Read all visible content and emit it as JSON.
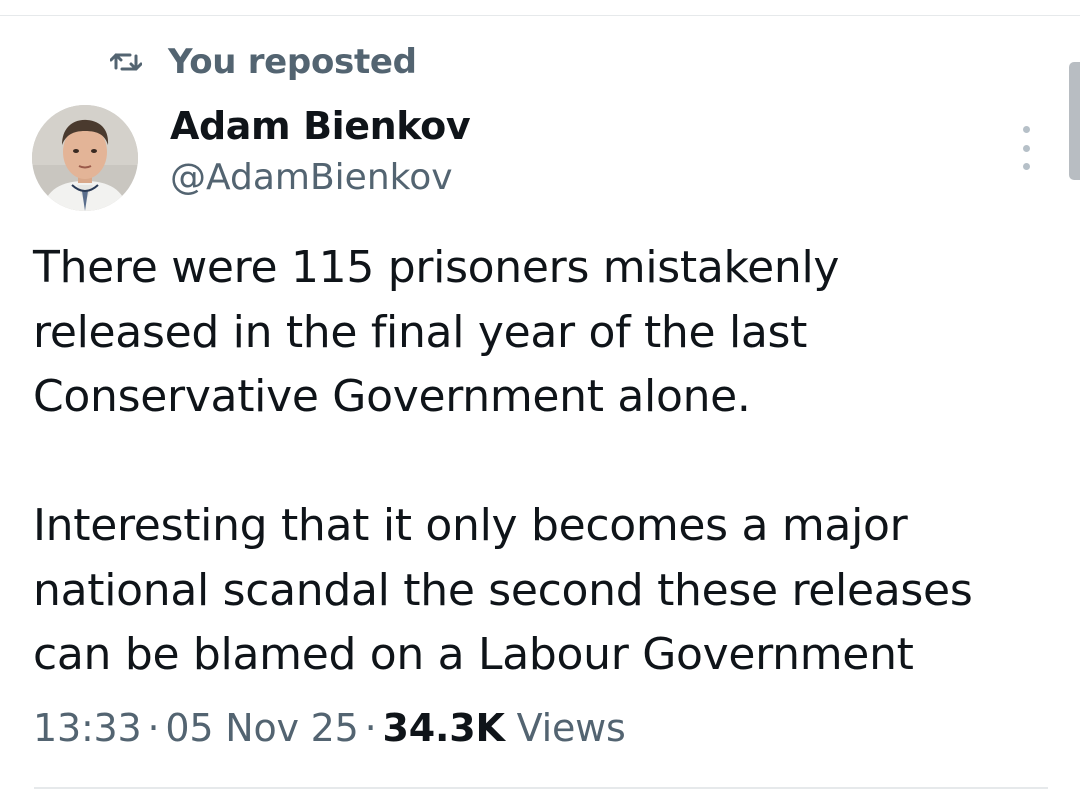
{
  "repost": {
    "icon": "repost-icon",
    "label": "You reposted"
  },
  "author": {
    "display_name": "Adam Bienkov",
    "handle": "@AdamBienkov",
    "avatar": "profile-photo"
  },
  "tweet": {
    "paragraphs": [
      "There were 115 prisoners mistakenly\nreleased in the final year of the last\nConservative Government alone.",
      "Interesting that it only becomes a major\nnational scandal the second these releases\ncan be blamed on a Labour Government"
    ]
  },
  "meta": {
    "time": "13:33",
    "separator": "·",
    "date": "05 Nov 25",
    "views_count": "34.3K",
    "views_label": "Views"
  },
  "menu": {
    "icon": "more-vertical-icon"
  },
  "colors": {
    "text_primary": "#0f1419",
    "text_secondary": "#536471",
    "divider": "#e6e9eb"
  }
}
